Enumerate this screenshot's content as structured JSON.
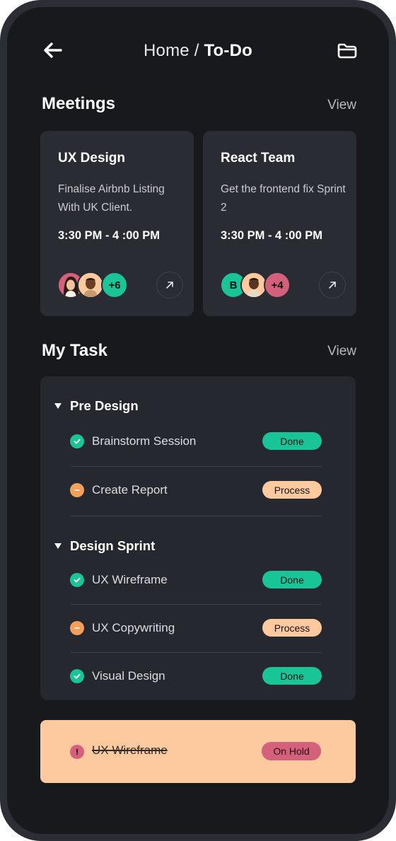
{
  "header": {
    "crumb_home": "Home / ",
    "crumb_current": "To-Do"
  },
  "meetings": {
    "title": "Meetings",
    "view_label": "View",
    "cards": [
      {
        "title": "UX Design",
        "description": "Finalise Airbnb Listing With UK Client.",
        "time": "3:30 PM - 4 :00 PM",
        "extra_count": "+6",
        "count_color": "#19c496"
      },
      {
        "title": "React Team",
        "description": "Get the frontend fix Sprint 2",
        "time": "3:30 PM - 4 :00 PM",
        "initial": "B",
        "extra_count": "+4",
        "count_color": "#d4607c"
      }
    ]
  },
  "tasks": {
    "title": "My Task",
    "view_label": "View",
    "groups": [
      {
        "name": "Pre Design",
        "items": [
          {
            "label": "Brainstorm Session",
            "status": "Done"
          },
          {
            "label": "Create Report",
            "status": "Process"
          }
        ]
      },
      {
        "name": "Design Sprint",
        "items": [
          {
            "label": "UX Wireframe",
            "status": "Done"
          },
          {
            "label": "UX Copywriting",
            "status": "Process"
          },
          {
            "label": "Visual Design",
            "status": "Done"
          }
        ]
      }
    ],
    "on_hold": {
      "label": "UX Wireframe",
      "status": "On Hold"
    }
  },
  "colors": {
    "done": "#19c496",
    "process": "#fdc99e",
    "process_icon": "#f4a05a",
    "hold": "#d4607c"
  }
}
